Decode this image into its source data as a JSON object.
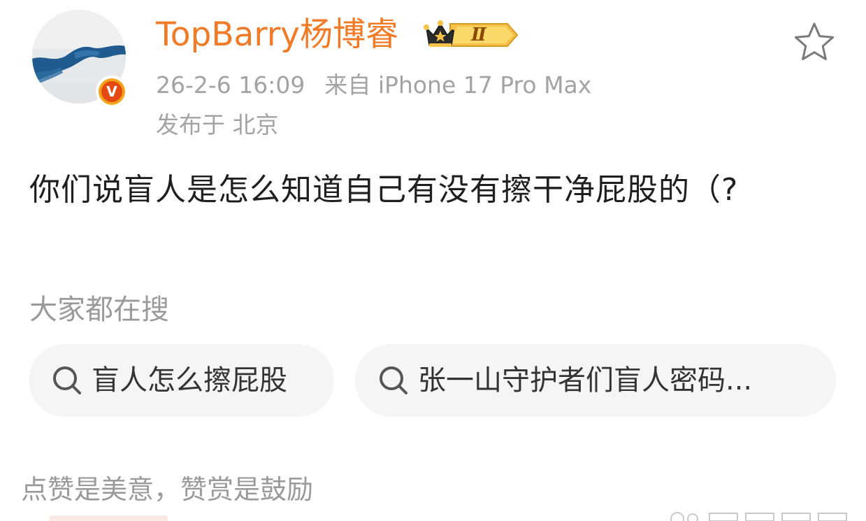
{
  "header": {
    "username": "TopBarry杨博睿",
    "level_badge_text": "Ⅱ",
    "timestamp": "26-2-6 16:09",
    "source": "来自 iPhone 17 Pro Max",
    "location": "发布于 北京",
    "verified_badge_letter": "V"
  },
  "post": {
    "text": "你们说盲人是怎么知道自己有没有擦干净屁股的（?"
  },
  "hot_search": {
    "title": "大家都在搜",
    "items": [
      {
        "label": "盲人怎么擦屁股",
        "icon": "search-icon"
      },
      {
        "label": "张一山守护者们盲人密码...",
        "icon": "search-icon"
      }
    ]
  },
  "footer": {
    "reward_text": "点赞是美意，赞赏是鼓励"
  },
  "colors": {
    "username": "#f07a26",
    "meta": "#a3a3a3",
    "body_text": "#1f1f1f",
    "chip_bg": "#f5f5f5",
    "verified_orange": "#e54a12",
    "badge_gold": "#f4b73a"
  },
  "icons": {
    "favorite": "star-outline-icon",
    "level": "crown-level-badge-icon",
    "verified": "verified-v-icon"
  }
}
